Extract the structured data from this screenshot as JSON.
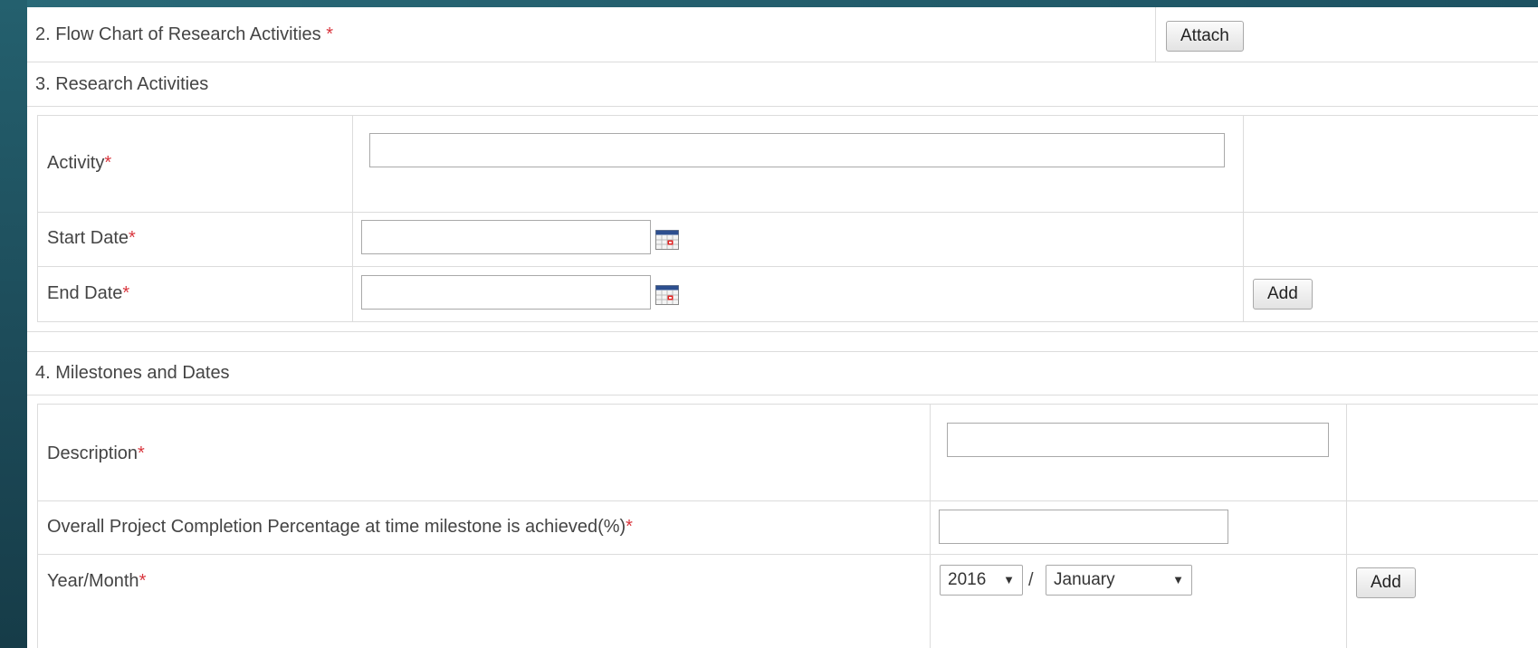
{
  "sections": {
    "flow_chart": {
      "title": "2. Flow Chart of Research Activities",
      "required_mark": "*",
      "attach_button": "Attach"
    },
    "research_activities": {
      "title": "3. Research Activities",
      "activity_label": "Activity",
      "start_date_label": "Start Date",
      "end_date_label": "End Date",
      "required_mark": "*",
      "add_button": "Add",
      "activity_value": "",
      "start_date_value": "",
      "end_date_value": ""
    },
    "milestones": {
      "title": "4. Milestones and Dates",
      "description_label": "Description",
      "completion_label": "Overall Project Completion Percentage at time milestone is achieved(%)",
      "year_month_label": "Year/Month",
      "required_mark": "*",
      "year_selected": "2016",
      "separator": "/",
      "month_selected": "January",
      "add_button": "Add",
      "description_value": "",
      "completion_value": ""
    }
  },
  "icons": {
    "calendar": "calendar-icon",
    "dropdown": "chevron-down-icon"
  },
  "colors": {
    "frame": "#1f4e5c",
    "required": "#d9363e"
  }
}
